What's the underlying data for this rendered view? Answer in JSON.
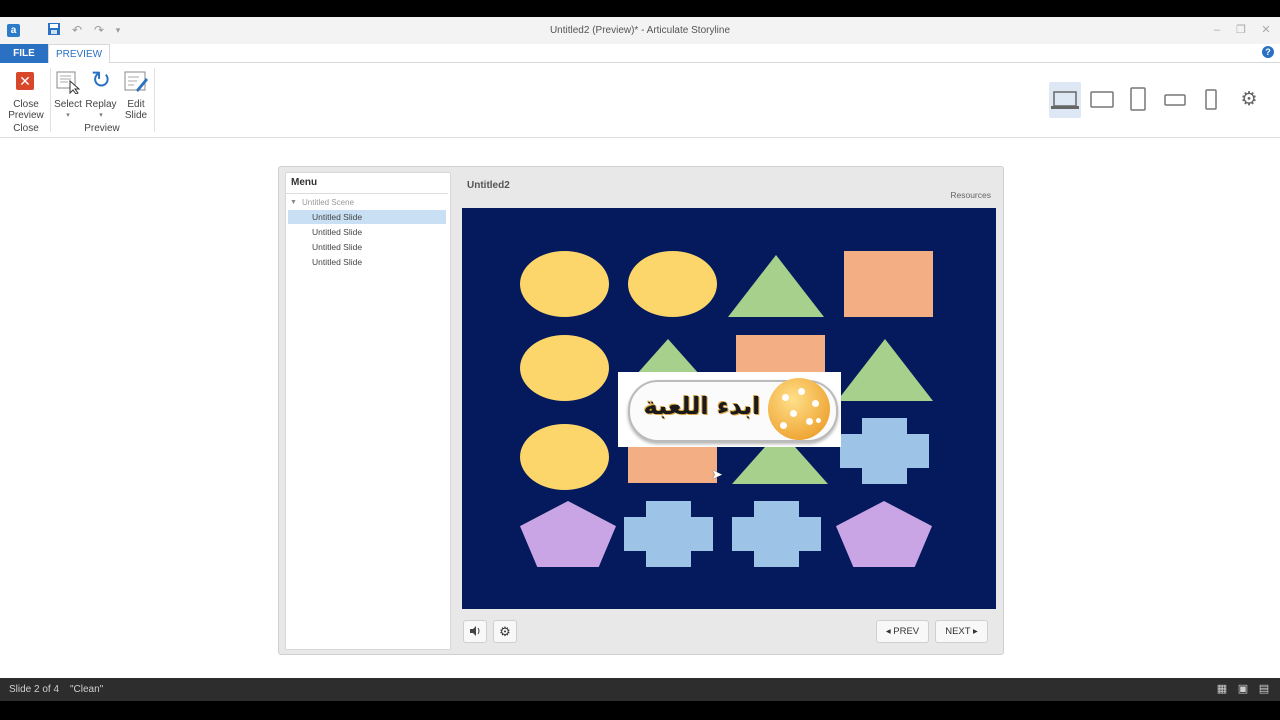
{
  "window": {
    "title": "Untitled2 (Preview)* - Articulate Storyline",
    "app_logo_letter": "a"
  },
  "quick_access": {
    "save_icon": "save-icon",
    "undo_icon": "undo-icon",
    "redo_icon": "redo-icon",
    "customize_icon": "dropdown-icon"
  },
  "ribbon": {
    "tabs": [
      {
        "label": "FILE",
        "active": false
      },
      {
        "label": "PREVIEW",
        "active": true
      }
    ],
    "groups": [
      {
        "label": "Close",
        "buttons": [
          {
            "label_line1": "Close",
            "label_line2": "Preview",
            "icon": "close-x-icon"
          }
        ]
      },
      {
        "label": "Preview",
        "buttons": [
          {
            "label_line1": "Select",
            "icon": "select-icon"
          },
          {
            "label_line1": "Replay",
            "icon": "replay-icon"
          },
          {
            "label_line1": "Edit",
            "label_line2": "Slide",
            "icon": "edit-slide-icon"
          }
        ]
      }
    ],
    "devices": [
      "desktop-icon",
      "tablet-landscape-icon",
      "tablet-portrait-icon",
      "phone-landscape-icon",
      "phone-portrait-icon",
      "gear-icon"
    ],
    "selected_device": "desktop-icon"
  },
  "player": {
    "menu_title": "Menu",
    "scene_label": "Untitled Scene",
    "menu_items": [
      {
        "label": "Untitled Slide",
        "selected": true
      },
      {
        "label": "Untitled Slide",
        "selected": false
      },
      {
        "label": "Untitled Slide",
        "selected": false
      },
      {
        "label": "Untitled Slide",
        "selected": false
      }
    ],
    "slide_title": "Untitled2",
    "resources_label": "Resources",
    "prev_label": "PREV",
    "next_label": "NEXT",
    "stage": {
      "background": "#041a5c",
      "start_button_text": "ابدء اللعبة",
      "colors": {
        "ellipse": "#fcd66a",
        "triangle": "#a8d08d",
        "square": "#f3ae83",
        "cross": "#9dc3e6",
        "pentagon": "#c9a5e6"
      }
    }
  },
  "status": {
    "slide_info": "Slide 2 of 4",
    "theme": "\"Clean\""
  }
}
